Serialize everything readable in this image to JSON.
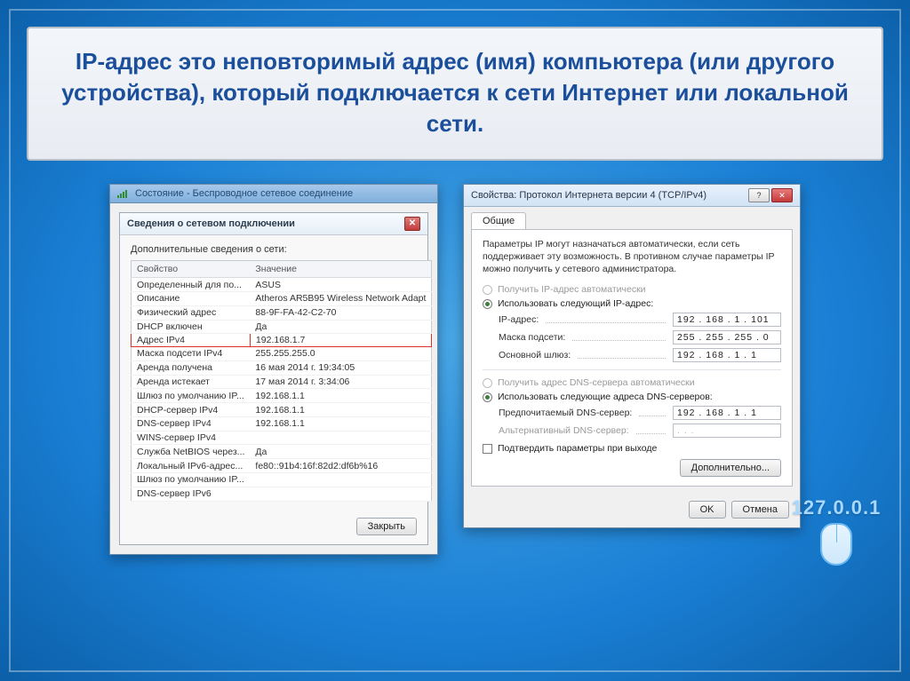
{
  "slide": {
    "title": "IP-адрес это неповторимый адрес (имя) компьютера (или другого устройства), который подключается к сети Интернет или локальной сети."
  },
  "decor_ip": "127.0.0.1",
  "left": {
    "parent_title": "Состояние - Беспроводное сетевое соединение",
    "dialog_title": "Сведения о сетевом подключении",
    "caption": "Дополнительные сведения о сети:",
    "col_property": "Свойство",
    "col_value": "Значение",
    "rows": [
      {
        "p": "Определенный для по...",
        "v": "ASUS"
      },
      {
        "p": "Описание",
        "v": "Atheros AR5B95 Wireless Network Adapt"
      },
      {
        "p": "Физический адрес",
        "v": "88-9F-FA-42-C2-70"
      },
      {
        "p": "DHCP включен",
        "v": "Да"
      },
      {
        "p": "Адрес IPv4",
        "v": "192.168.1.7",
        "hl": true
      },
      {
        "p": "Маска подсети IPv4",
        "v": "255.255.255.0"
      },
      {
        "p": "Аренда получена",
        "v": "16 мая 2014 г. 19:34:05"
      },
      {
        "p": "Аренда истекает",
        "v": "17 мая 2014 г. 3:34:06"
      },
      {
        "p": "Шлюз по умолчанию IP...",
        "v": "192.168.1.1"
      },
      {
        "p": "DHCP-сервер IPv4",
        "v": "192.168.1.1"
      },
      {
        "p": "DNS-сервер IPv4",
        "v": "192.168.1.1"
      },
      {
        "p": "WINS-сервер IPv4",
        "v": ""
      },
      {
        "p": "Служба NetBIOS через...",
        "v": "Да"
      },
      {
        "p": "Локальный IPv6-адрес...",
        "v": "fe80::91b4:16f:82d2:df6b%16"
      },
      {
        "p": "Шлюз по умолчанию IP...",
        "v": ""
      },
      {
        "p": "DNS-сервер IPv6",
        "v": ""
      }
    ],
    "close_btn": "Закрыть"
  },
  "right": {
    "window_title": "Свойства: Протокол Интернета версии 4 (TCP/IPv4)",
    "tab": "Общие",
    "desc": "Параметры IP могут назначаться автоматически, если сеть поддерживает эту возможность. В противном случае параметры IP можно получить у сетевого администратора.",
    "radio_auto_ip": "Получить IP-адрес автоматически",
    "radio_use_ip": "Использовать следующий IP-адрес:",
    "lbl_ip": "IP-адрес:",
    "val_ip": "192 . 168 .  1  . 101",
    "lbl_mask": "Маска подсети:",
    "val_mask": "255 . 255 . 255 .  0",
    "lbl_gw": "Основной шлюз:",
    "val_gw": "192 . 168 .  1  .  1",
    "radio_auto_dns": "Получить адрес DNS-сервера автоматически",
    "radio_use_dns": "Использовать следующие адреса DNS-серверов:",
    "lbl_dns1": "Предпочитаемый DNS-сервер:",
    "val_dns1": "192 . 168 .  1  .  1",
    "lbl_dns2": "Альтернативный DNS-сервер:",
    "val_dns2": " .  .  . ",
    "chk_validate": "Подтвердить параметры при выходе",
    "btn_adv": "Дополнительно...",
    "btn_ok": "OK",
    "btn_cancel": "Отмена"
  }
}
